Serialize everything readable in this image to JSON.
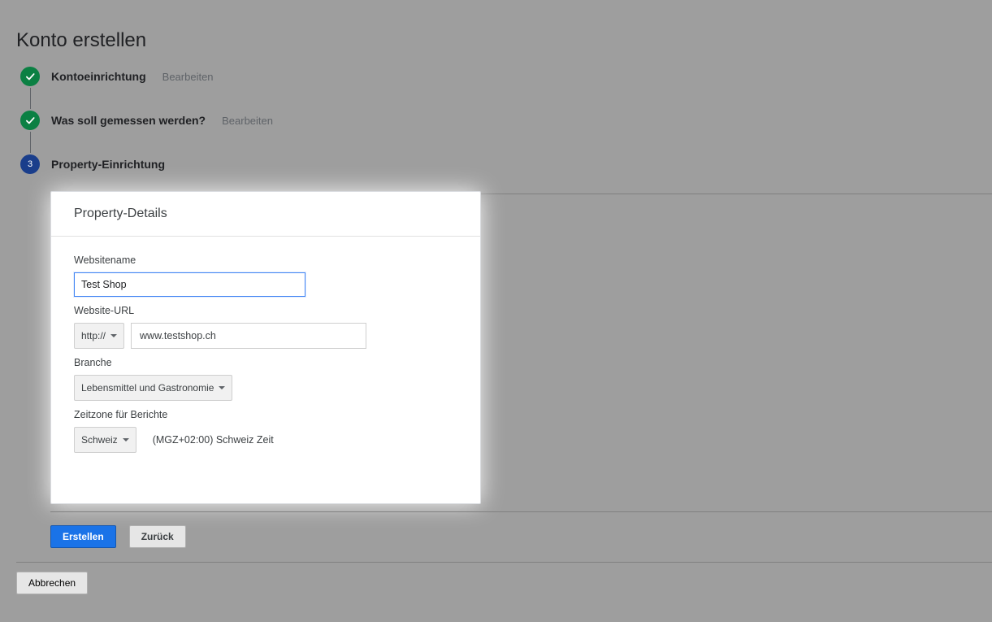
{
  "page": {
    "title": "Konto erstellen"
  },
  "steps": {
    "s1": {
      "label": "Kontoeinrichtung",
      "edit": "Bearbeiten"
    },
    "s2": {
      "label": "Was soll gemessen werden?",
      "edit": "Bearbeiten"
    },
    "s3": {
      "num": "3",
      "label": "Property-Einrichtung"
    }
  },
  "card": {
    "header": "Property-Details",
    "site_name_label": "Websitename",
    "site_name_value": "Test Shop",
    "url_label": "Website-URL",
    "protocol_value": "http://",
    "url_value": "www.testshop.ch",
    "industry_label": "Branche",
    "industry_value": "Lebensmittel und Gastronomie",
    "timezone_label": "Zeitzone für Berichte",
    "timezone_value": "Schweiz",
    "timezone_desc": "(MGZ+02:00) Schweiz Zeit"
  },
  "buttons": {
    "create": "Erstellen",
    "back": "Zurück",
    "cancel": "Abbrechen"
  }
}
